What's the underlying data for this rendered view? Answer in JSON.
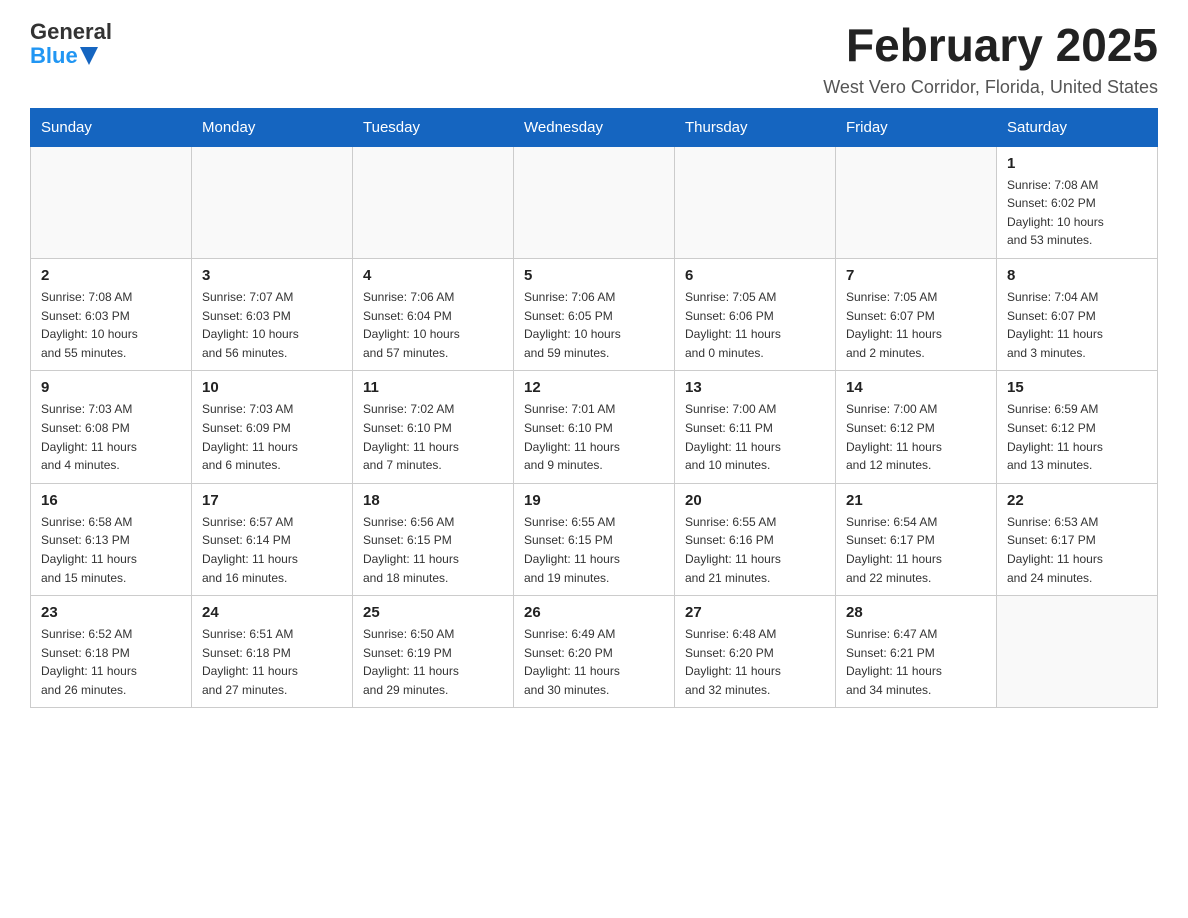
{
  "logo": {
    "general": "General",
    "blue": "Blue"
  },
  "title": "February 2025",
  "subtitle": "West Vero Corridor, Florida, United States",
  "days_of_week": [
    "Sunday",
    "Monday",
    "Tuesday",
    "Wednesday",
    "Thursday",
    "Friday",
    "Saturday"
  ],
  "weeks": [
    [
      {
        "day": "",
        "info": ""
      },
      {
        "day": "",
        "info": ""
      },
      {
        "day": "",
        "info": ""
      },
      {
        "day": "",
        "info": ""
      },
      {
        "day": "",
        "info": ""
      },
      {
        "day": "",
        "info": ""
      },
      {
        "day": "1",
        "info": "Sunrise: 7:08 AM\nSunset: 6:02 PM\nDaylight: 10 hours\nand 53 minutes."
      }
    ],
    [
      {
        "day": "2",
        "info": "Sunrise: 7:08 AM\nSunset: 6:03 PM\nDaylight: 10 hours\nand 55 minutes."
      },
      {
        "day": "3",
        "info": "Sunrise: 7:07 AM\nSunset: 6:03 PM\nDaylight: 10 hours\nand 56 minutes."
      },
      {
        "day": "4",
        "info": "Sunrise: 7:06 AM\nSunset: 6:04 PM\nDaylight: 10 hours\nand 57 minutes."
      },
      {
        "day": "5",
        "info": "Sunrise: 7:06 AM\nSunset: 6:05 PM\nDaylight: 10 hours\nand 59 minutes."
      },
      {
        "day": "6",
        "info": "Sunrise: 7:05 AM\nSunset: 6:06 PM\nDaylight: 11 hours\nand 0 minutes."
      },
      {
        "day": "7",
        "info": "Sunrise: 7:05 AM\nSunset: 6:07 PM\nDaylight: 11 hours\nand 2 minutes."
      },
      {
        "day": "8",
        "info": "Sunrise: 7:04 AM\nSunset: 6:07 PM\nDaylight: 11 hours\nand 3 minutes."
      }
    ],
    [
      {
        "day": "9",
        "info": "Sunrise: 7:03 AM\nSunset: 6:08 PM\nDaylight: 11 hours\nand 4 minutes."
      },
      {
        "day": "10",
        "info": "Sunrise: 7:03 AM\nSunset: 6:09 PM\nDaylight: 11 hours\nand 6 minutes."
      },
      {
        "day": "11",
        "info": "Sunrise: 7:02 AM\nSunset: 6:10 PM\nDaylight: 11 hours\nand 7 minutes."
      },
      {
        "day": "12",
        "info": "Sunrise: 7:01 AM\nSunset: 6:10 PM\nDaylight: 11 hours\nand 9 minutes."
      },
      {
        "day": "13",
        "info": "Sunrise: 7:00 AM\nSunset: 6:11 PM\nDaylight: 11 hours\nand 10 minutes."
      },
      {
        "day": "14",
        "info": "Sunrise: 7:00 AM\nSunset: 6:12 PM\nDaylight: 11 hours\nand 12 minutes."
      },
      {
        "day": "15",
        "info": "Sunrise: 6:59 AM\nSunset: 6:12 PM\nDaylight: 11 hours\nand 13 minutes."
      }
    ],
    [
      {
        "day": "16",
        "info": "Sunrise: 6:58 AM\nSunset: 6:13 PM\nDaylight: 11 hours\nand 15 minutes."
      },
      {
        "day": "17",
        "info": "Sunrise: 6:57 AM\nSunset: 6:14 PM\nDaylight: 11 hours\nand 16 minutes."
      },
      {
        "day": "18",
        "info": "Sunrise: 6:56 AM\nSunset: 6:15 PM\nDaylight: 11 hours\nand 18 minutes."
      },
      {
        "day": "19",
        "info": "Sunrise: 6:55 AM\nSunset: 6:15 PM\nDaylight: 11 hours\nand 19 minutes."
      },
      {
        "day": "20",
        "info": "Sunrise: 6:55 AM\nSunset: 6:16 PM\nDaylight: 11 hours\nand 21 minutes."
      },
      {
        "day": "21",
        "info": "Sunrise: 6:54 AM\nSunset: 6:17 PM\nDaylight: 11 hours\nand 22 minutes."
      },
      {
        "day": "22",
        "info": "Sunrise: 6:53 AM\nSunset: 6:17 PM\nDaylight: 11 hours\nand 24 minutes."
      }
    ],
    [
      {
        "day": "23",
        "info": "Sunrise: 6:52 AM\nSunset: 6:18 PM\nDaylight: 11 hours\nand 26 minutes."
      },
      {
        "day": "24",
        "info": "Sunrise: 6:51 AM\nSunset: 6:18 PM\nDaylight: 11 hours\nand 27 minutes."
      },
      {
        "day": "25",
        "info": "Sunrise: 6:50 AM\nSunset: 6:19 PM\nDaylight: 11 hours\nand 29 minutes."
      },
      {
        "day": "26",
        "info": "Sunrise: 6:49 AM\nSunset: 6:20 PM\nDaylight: 11 hours\nand 30 minutes."
      },
      {
        "day": "27",
        "info": "Sunrise: 6:48 AM\nSunset: 6:20 PM\nDaylight: 11 hours\nand 32 minutes."
      },
      {
        "day": "28",
        "info": "Sunrise: 6:47 AM\nSunset: 6:21 PM\nDaylight: 11 hours\nand 34 minutes."
      },
      {
        "day": "",
        "info": ""
      }
    ]
  ]
}
